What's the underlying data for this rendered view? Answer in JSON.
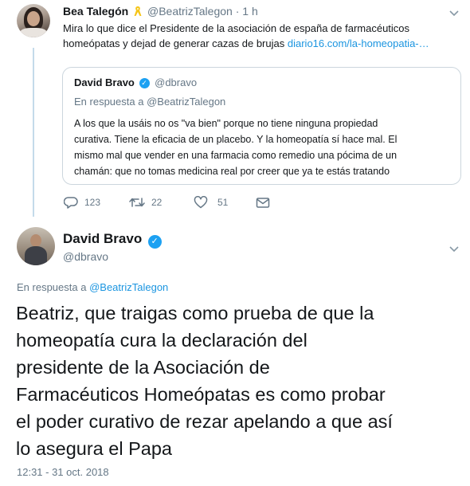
{
  "first_tweet": {
    "author_name": "Bea Talegón",
    "ribbon_icon": "yellow-ribbon-icon",
    "handle": "@BeatrizTalegon",
    "separator": "·",
    "time": "1 h",
    "text": "Mira lo que dice el Presidente de la asociación de españa de farmacéuticos",
    "text_line2": "homeópatas y dejad de generar cazas de brujas",
    "link": "diario16.com/la-homeopatia-…"
  },
  "quoted_tweet": {
    "author_name": "David Bravo",
    "handle": "@dbravo",
    "reply_prefix": "En respuesta a",
    "reply_handle": "@BeatrizTalegon",
    "lines": [
      "A los que la usáis no os \"va bien\" porque no tiene ninguna propiedad",
      "curativa. Tiene la eficacia de un placebo. Y la homeopatía sí hace mal. El",
      "mismo mal que vender en una farmacia como remedio una pócima de un",
      "chamán: que no tomas medicina real por creer que ya te estás tratando"
    ]
  },
  "actions": {
    "replies": "123",
    "retweets": "22",
    "likes": "51"
  },
  "main_tweet": {
    "author_name": "David Bravo",
    "handle": "@dbravo",
    "reply_prefix": "En respuesta a",
    "reply_handle": "@BeatrizTalegon",
    "lines": [
      "Beatriz, que traigas como prueba de que la",
      "homeopatía cura la declaración del",
      "presidente de la Asociación de",
      "Farmacéuticos Homeópatas es como probar",
      "el poder curativo de rezar apelando a que así",
      "lo asegura el Papa"
    ],
    "timestamp": "12:31 - 31 oct. 2018"
  },
  "colors": {
    "link_blue": "#1b95e0",
    "text": "#14171a",
    "secondary": "#657786",
    "border": "#ccd6dd",
    "thread": "#c4dbea",
    "verified": "#1da1f2",
    "ribbon": "#f5c518"
  }
}
